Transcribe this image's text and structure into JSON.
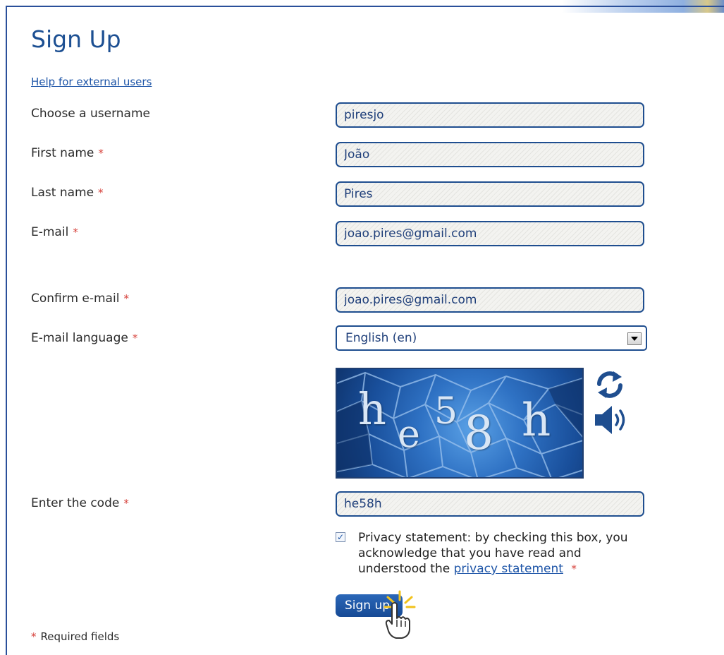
{
  "page": {
    "title": "Sign Up",
    "help_link": "Help for external users"
  },
  "form": {
    "username": {
      "label": "Choose a username",
      "value": "piresjo"
    },
    "first_name": {
      "label": "First name",
      "required": "*",
      "value": "João"
    },
    "last_name": {
      "label": "Last name",
      "required": "*",
      "value": "Pires"
    },
    "email": {
      "label": "E-mail",
      "required": "*",
      "value": "joao.pires@gmail.com"
    },
    "confirm_email": {
      "label": "Confirm e-mail",
      "required": "*",
      "value": "joao.pires@gmail.com"
    },
    "email_language": {
      "label": "E-mail language",
      "required": "*",
      "selected": "English (en)"
    },
    "captcha": {
      "characters": "he58h",
      "refresh_icon": "refresh-icon",
      "audio_icon": "speaker-icon"
    },
    "code": {
      "label": "Enter the code",
      "required": "*",
      "value": "he58h"
    },
    "privacy": {
      "checked": true,
      "text": "Privacy statement: by checking this box, you acknowledge that you have read and understood the",
      "link": "privacy statement",
      "required": "*"
    },
    "submit_label": "Sign up"
  },
  "footer": {
    "required_mark": "*",
    "required_note": "Required fields"
  },
  "colors": {
    "accent": "#1c4f92",
    "required": "#d6403a",
    "button": "#1d55a5"
  }
}
